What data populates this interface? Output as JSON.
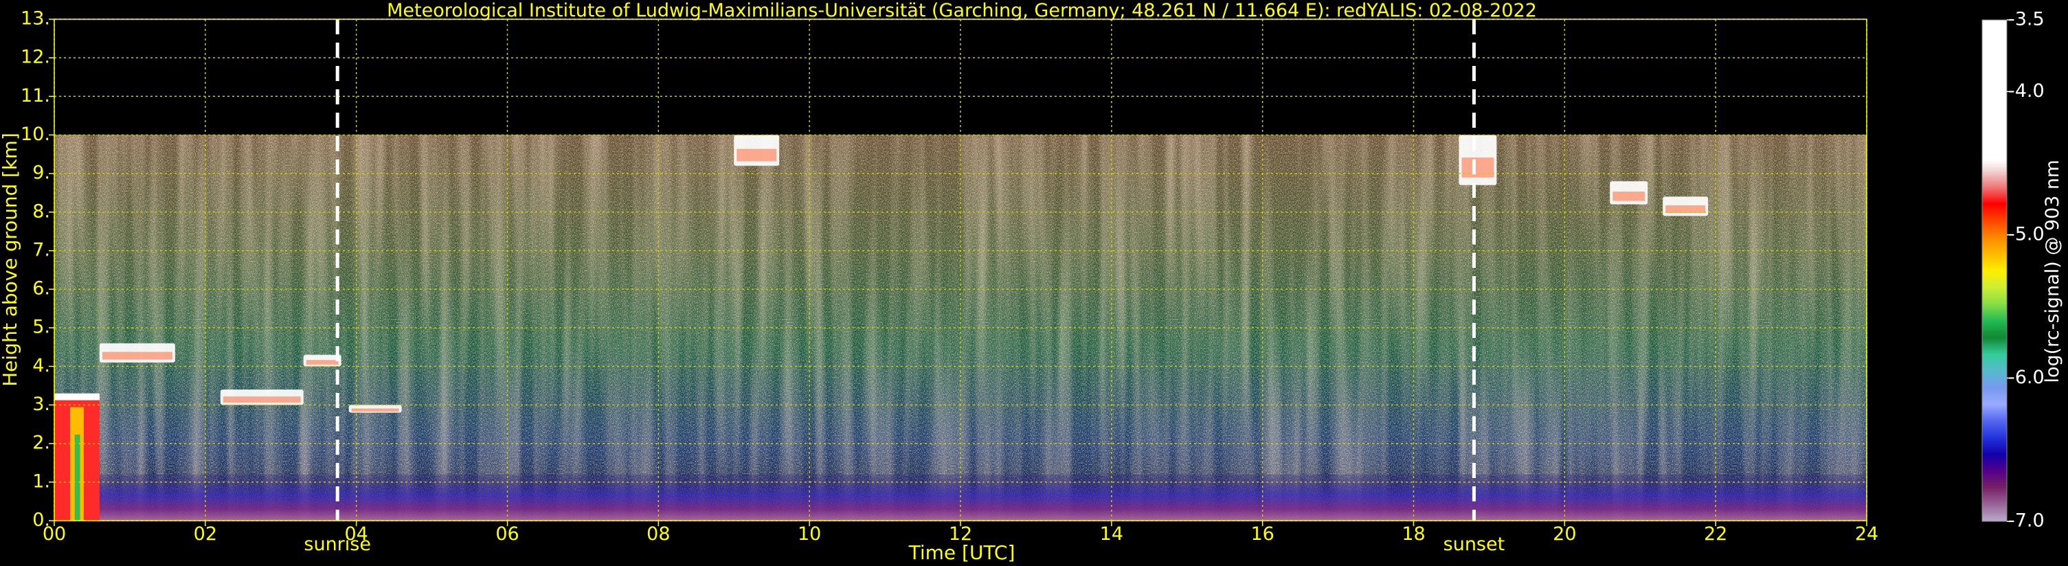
{
  "chart_data": {
    "type": "heatmap",
    "title": "Meteorological Institute of Ludwig-Maximilians-Universität (Garching, Germany; 48.261 N / 11.664 E):    redYALIS: 02-08-2022",
    "xlabel": "Time [UTC]",
    "ylabel": "Height above ground [km]",
    "xlim": [
      0,
      24
    ],
    "ylim": [
      0,
      13
    ],
    "data_top_km": 10,
    "x_ticks": [
      "00",
      "02",
      "04",
      "06",
      "08",
      "10",
      "12",
      "14",
      "16",
      "18",
      "20",
      "22",
      "24"
    ],
    "y_ticks": [
      "0.",
      "1.",
      "2.",
      "3.",
      "4.",
      "5.",
      "6.",
      "7.",
      "8.",
      "9.",
      "10.",
      "11.",
      "12.",
      "13."
    ],
    "grid": true,
    "events": [
      {
        "label": "sunrise",
        "time_utc": 3.75
      },
      {
        "label": "sunset",
        "time_utc": 18.8
      }
    ],
    "colorbar": {
      "label": "log(rc-signal) @ 903 nm",
      "range": [
        -7.0,
        -3.5
      ],
      "ticks": [
        "-3.5",
        "-4.0",
        "-5.0",
        "-6.0",
        "-7.0"
      ],
      "colors_top_to_bottom": [
        "#ffffff",
        "#f2d6d6",
        "#f07878",
        "#ff0000",
        "#ff4400",
        "#ff8800",
        "#ffbb00",
        "#ffee00",
        "#ccee33",
        "#88dd44",
        "#22bb55",
        "#118833",
        "#33cc99",
        "#55bbcc",
        "#7799ee",
        "#99aaff",
        "#5566ee",
        "#2233dd",
        "#1100aa",
        "#550088",
        "#772266",
        "#996699",
        "#bbaacc"
      ]
    },
    "features": [
      {
        "kind": "boundary-layer",
        "t_start": 0,
        "t_end": 24,
        "height_km": [
          0,
          1.2
        ]
      },
      {
        "kind": "low-cloud",
        "t_start": 0,
        "t_end": 0.6,
        "height_km": [
          0,
          3.3
        ]
      },
      {
        "kind": "cloud",
        "t_start": 0.6,
        "t_end": 1.6,
        "height_km": [
          4.1,
          4.6
        ]
      },
      {
        "kind": "cloud",
        "t_start": 2.2,
        "t_end": 3.3,
        "height_km": [
          3.0,
          3.4
        ]
      },
      {
        "kind": "cloud",
        "t_start": 3.3,
        "t_end": 3.8,
        "height_km": [
          4.0,
          4.3
        ]
      },
      {
        "kind": "cloud",
        "t_start": 3.9,
        "t_end": 4.6,
        "height_km": [
          2.8,
          3.0
        ]
      },
      {
        "kind": "cirrus",
        "t_start": 9.0,
        "t_end": 9.6,
        "height_km": [
          9.2,
          10
        ]
      },
      {
        "kind": "cirrus",
        "t_start": 18.6,
        "t_end": 19.1,
        "height_km": [
          8.7,
          10
        ]
      },
      {
        "kind": "cirrus",
        "t_start": 20.6,
        "t_end": 21.1,
        "height_km": [
          8.2,
          8.8
        ]
      },
      {
        "kind": "cirrus",
        "t_start": 21.3,
        "t_end": 21.9,
        "height_km": [
          7.9,
          8.4
        ]
      }
    ]
  }
}
